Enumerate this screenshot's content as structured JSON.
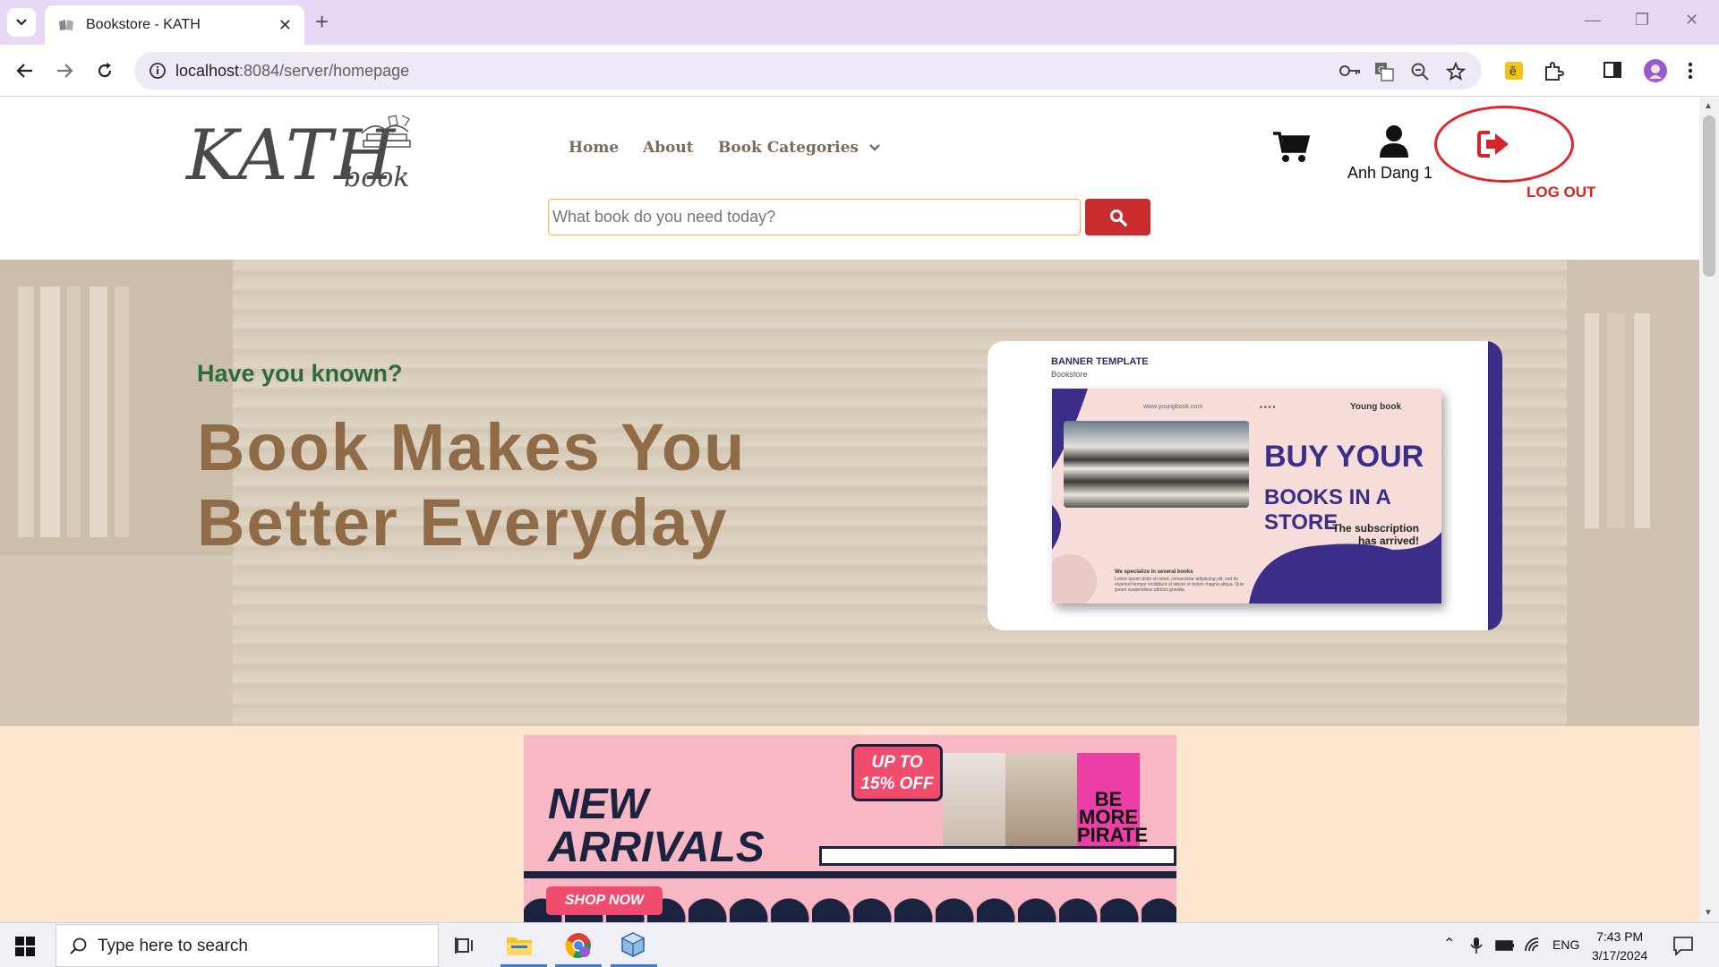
{
  "browser": {
    "tab_title": "Bookstore - KATH",
    "url_host": "localhost",
    "url_path": ":8084/server/homepage"
  },
  "site": {
    "logo_main": "KATH",
    "logo_sub": "book",
    "nav": {
      "home": "Home",
      "about": "About",
      "categories": "Book Categories"
    },
    "search_placeholder": "What book do you need today?",
    "username": "Anh Dang 1",
    "logout_label": "LOG OUT"
  },
  "hero": {
    "kicker": "Have you known?",
    "headline_line1": "Book Makes You",
    "headline_line2": "Better Everyday",
    "banner": {
      "title": "BANNER TEMPLATE",
      "subtitle": "Bookstore",
      "url": "www.youngbook.com",
      "brand": "Young book",
      "headline1": "BUY YOUR",
      "headline2": "BOOKS IN A STORE",
      "tagline": "The subscription has arrived!",
      "spec": "We specialize in several books",
      "lorem": "Lorem ipsum dolor sit amet, consectetur adipiscing elit, sed do eiusmod tempor incididunt ut labore et dolore magna aliqua. Quis ipsum suspendisse ultrices gravida."
    }
  },
  "promo": {
    "line1": "NEW",
    "line2": "ARRIVALS",
    "discount": "UP TO 15% OFF",
    "shop_now": "SHOP NOW",
    "book3_title": "BE MORE PIRATE"
  },
  "taskbar": {
    "search_placeholder": "Type here to search",
    "language": "ENG",
    "time": "7:43 PM",
    "date": "3/17/2024"
  },
  "colors": {
    "accent_red": "#c82c2c",
    "logout_red": "#d4252b",
    "kicker_green": "#2e6b3a",
    "headline_brown": "#8f6b48",
    "browser_purple": "#e7d9f5"
  }
}
